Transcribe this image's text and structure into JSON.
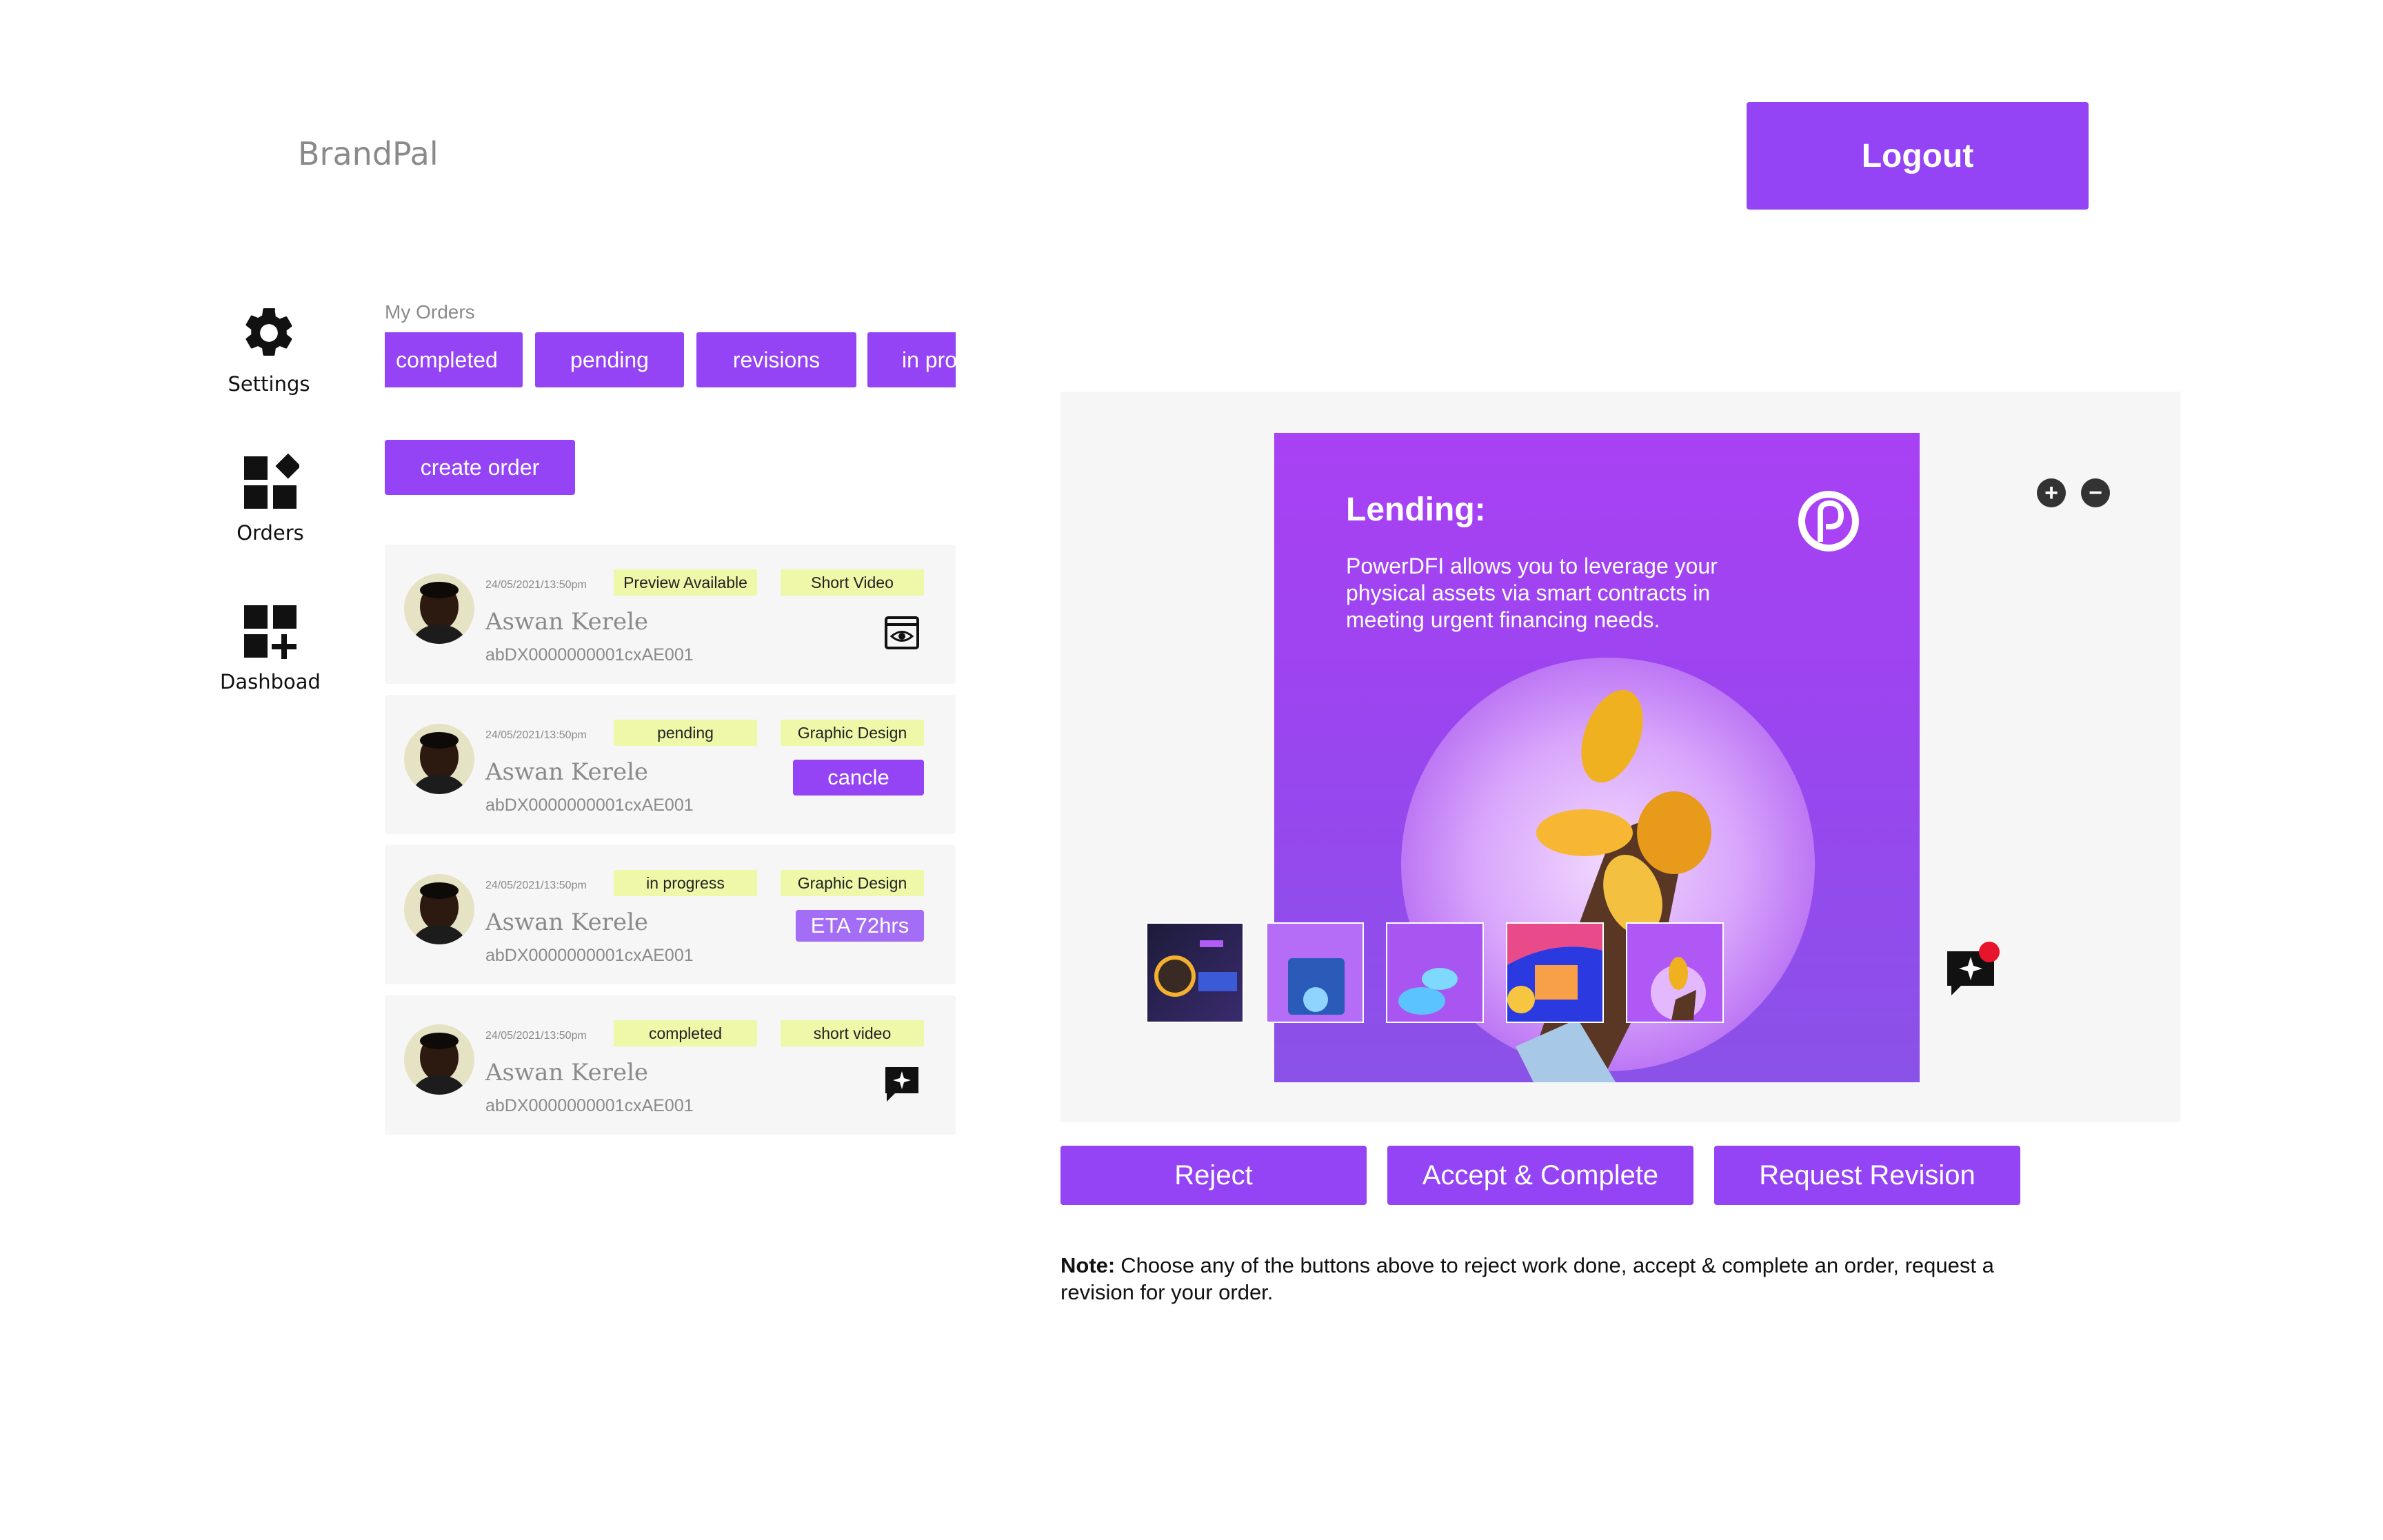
{
  "app": {
    "brand": "BrandPal",
    "logout_label": "Logout"
  },
  "sidebar": {
    "items": [
      {
        "label": "Settings",
        "icon": "gear-icon"
      },
      {
        "label": "Orders",
        "icon": "shapes-icon"
      },
      {
        "label": "Dashboad",
        "icon": "dashboard-add-icon"
      }
    ]
  },
  "orders": {
    "heading": "My Orders",
    "tabs": [
      "completed",
      "pending",
      "revisions",
      "in pro"
    ],
    "create_label": "create order",
    "cards": [
      {
        "timestamp": "24/05/2021/13:50pm",
        "status": "Preview Available",
        "type": "Short Video",
        "name": "Aswan Kerele",
        "code": "abDX0000000001cxAE001",
        "action": "preview-eye-icon"
      },
      {
        "timestamp": "24/05/2021/13:50pm",
        "status": "pending",
        "type": "Graphic Design",
        "name": "Aswan Kerele",
        "code": "abDX0000000001cxAE001",
        "action_label": "cancle"
      },
      {
        "timestamp": "24/05/2021/13:50pm",
        "status": "in progress",
        "type": "Graphic Design",
        "name": "Aswan Kerele",
        "code": "abDX0000000001cxAE001",
        "eta": "ETA 72hrs"
      },
      {
        "timestamp": "24/05/2021/13:50pm",
        "status": "completed",
        "type": "short video",
        "name": "Aswan Kerele",
        "code": "abDX0000000001cxAE001",
        "action": "chat-sparkle-icon"
      }
    ]
  },
  "preview": {
    "artwork_title": "Lending:",
    "artwork_body": "PowerDFI allows you to leverage your physical assets via smart contracts in meeting urgent financing needs.",
    "zoom_in": "+",
    "zoom_out": "−",
    "thumbnails": [
      "thumb-event",
      "thumb-lending-grid",
      "thumb-tokens",
      "thumb-advertising",
      "thumb-lending"
    ],
    "has_notification": true
  },
  "actions": {
    "reject": "Reject",
    "accept": "Accept & Complete",
    "revision": "Request Revision"
  },
  "note": {
    "label": "Note:",
    "text": "Choose any of the buttons above to reject work done, accept & complete an order, request a revision for your order."
  },
  "colors": {
    "accent": "#9443f5",
    "pill": "#eef8a8",
    "panel": "#f6f6f6",
    "notification": "#e8142c"
  }
}
